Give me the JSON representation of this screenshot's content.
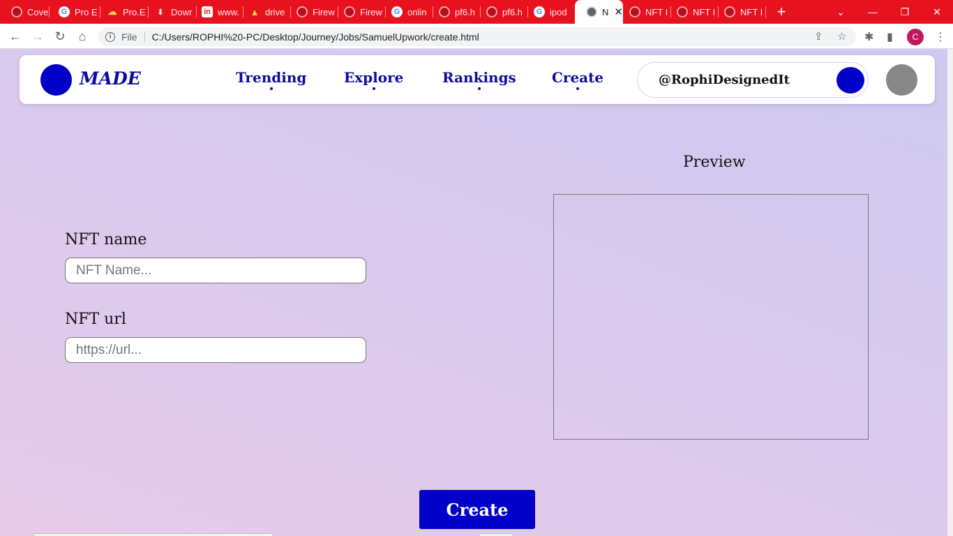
{
  "browser": {
    "tabs": [
      {
        "title": "Cove",
        "favicon": "globe-icon"
      },
      {
        "title": "Pro E",
        "favicon": "google-icon"
      },
      {
        "title": "Pro.E",
        "favicon": "cloud-icon"
      },
      {
        "title": "Dowr",
        "favicon": "download-icon"
      },
      {
        "title": "www.",
        "favicon": "linkedin-icon"
      },
      {
        "title": "drive",
        "favicon": "drive-icon"
      },
      {
        "title": "Firew",
        "favicon": "globe-icon"
      },
      {
        "title": "Firew",
        "favicon": "globe-icon"
      },
      {
        "title": "onlin",
        "favicon": "google-icon"
      },
      {
        "title": "pf6.h",
        "favicon": "globe-icon"
      },
      {
        "title": "pf6.h",
        "favicon": "globe-icon"
      },
      {
        "title": "ipod",
        "favicon": "google-icon"
      },
      {
        "title": "N",
        "favicon": "globe-icon",
        "active": true
      },
      {
        "title": "NFT I",
        "favicon": "globe-icon"
      },
      {
        "title": "NFT I",
        "favicon": "globe-icon"
      },
      {
        "title": "NFT I",
        "favicon": "globe-icon"
      }
    ],
    "address": {
      "scheme_label": "File",
      "url": "C:/Users/ROPHI%20-PC/Desktop/Journey/Jobs/SamuelUpwork/create.html"
    },
    "profile_initial": "C",
    "tabstrip_color": "#e8121f"
  },
  "site": {
    "logo": "MADE",
    "nav": [
      {
        "label": "Trending"
      },
      {
        "label": "Explore"
      },
      {
        "label": "Rankings"
      },
      {
        "label": "Create"
      }
    ],
    "user_handle": "@RophiDesignedIt",
    "accent_color": "#0000c8"
  },
  "form": {
    "name_label": "NFT name",
    "name_placeholder": "NFT Name...",
    "url_label": "NFT url",
    "url_placeholder": "https://url...",
    "submit_label": "Create"
  },
  "preview": {
    "title": "Preview"
  }
}
